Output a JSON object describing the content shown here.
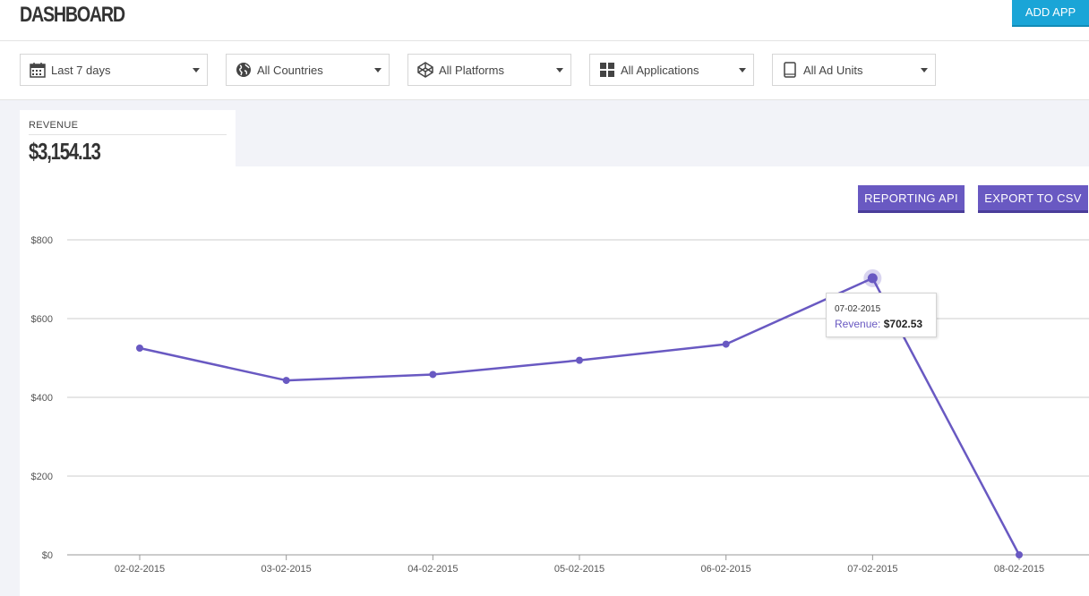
{
  "header": {
    "title": "DASHBOARD",
    "add_app_label": "ADD APP"
  },
  "filters": [
    {
      "label": "Last 7 days",
      "icon": "calendar-icon"
    },
    {
      "label": "All Countries",
      "icon": "globe-icon"
    },
    {
      "label": "All Platforms",
      "icon": "platforms-icon"
    },
    {
      "label": "All Applications",
      "icon": "grid-icon"
    },
    {
      "label": "All Ad Units",
      "icon": "tablet-icon"
    }
  ],
  "revenue": {
    "label": "REVENUE",
    "value": "$3,154.13"
  },
  "buttons": {
    "reporting_api": "REPORTING API",
    "export_csv": "EXPORT TO CSV"
  },
  "colors": {
    "accent": "#6959c2",
    "add_app": "#1aa5d7",
    "grid": "#cccccc"
  },
  "chart_data": {
    "type": "line",
    "title": "",
    "xlabel": "",
    "ylabel": "",
    "x": [
      "02-02-2015",
      "03-02-2015",
      "04-02-2015",
      "05-02-2015",
      "06-02-2015",
      "07-02-2015",
      "08-02-2015"
    ],
    "series": [
      {
        "name": "Revenue",
        "values": [
          525,
          443,
          458,
          494,
          535,
          702.53,
          0
        ]
      }
    ],
    "ylim": [
      0,
      800
    ],
    "yticks": [
      "$0",
      "$200",
      "$400",
      "$600",
      "$800"
    ],
    "grid": true,
    "tooltip": {
      "date": "07-02-2015",
      "series_label": "Revenue:",
      "value": "$702.53"
    }
  }
}
